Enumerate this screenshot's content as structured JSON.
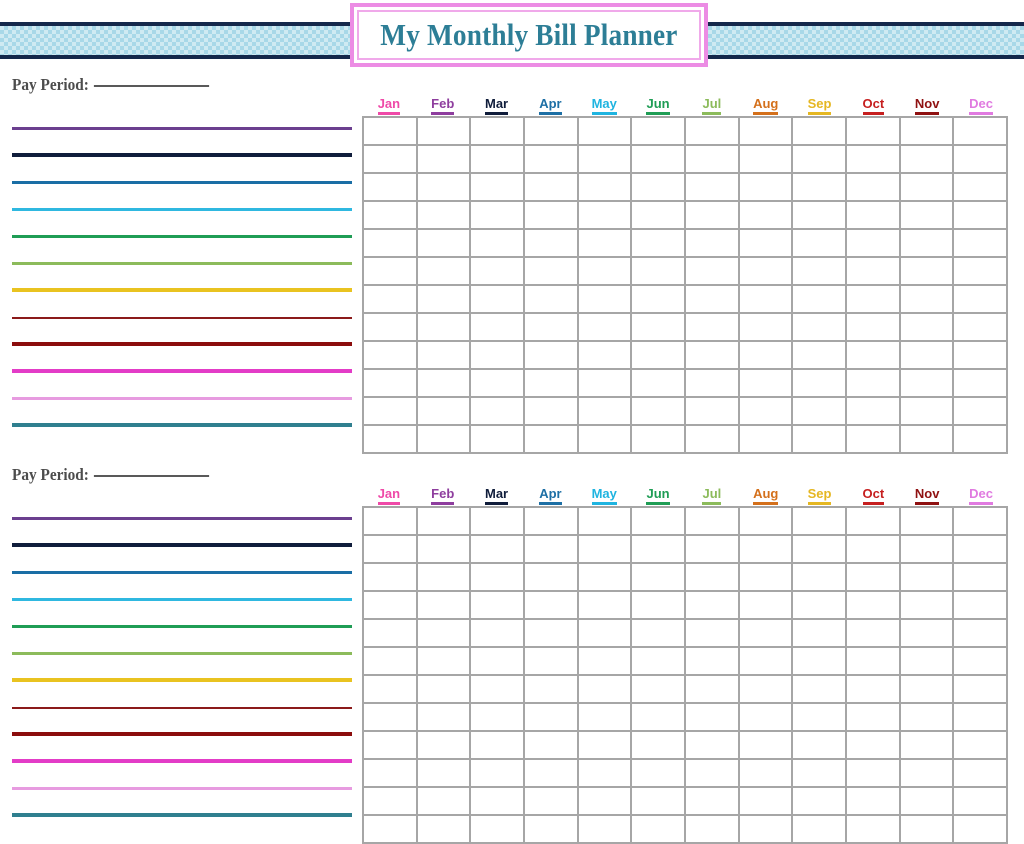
{
  "header": {
    "title": "My Monthly Bill Planner",
    "banner_color": "#cfeaf2",
    "banner_check_color": "#a8d8e8",
    "banner_border_color": "#14284b",
    "title_color": "#2d7e96",
    "title_border_color": "#ec8ce4",
    "title_inner_border_color": "#f0a9ea"
  },
  "months": [
    {
      "label": "Jan",
      "color": "#ef4aa8"
    },
    {
      "label": "Feb",
      "color": "#8e3d9e"
    },
    {
      "label": "Mar",
      "color": "#101d3b"
    },
    {
      "label": "Apr",
      "color": "#1d6fa5"
    },
    {
      "label": "May",
      "color": "#1fb4e0"
    },
    {
      "label": "Jun",
      "color": "#1f9d55"
    },
    {
      "label": "Jul",
      "color": "#8cbb5b"
    },
    {
      "label": "Aug",
      "color": "#d4701b"
    },
    {
      "label": "Sep",
      "color": "#e5b722"
    },
    {
      "label": "Oct",
      "color": "#c61f1f"
    },
    {
      "label": "Nov",
      "color": "#8f1111"
    },
    {
      "label": "Dec",
      "color": "#e07ae0"
    }
  ],
  "line_colors": [
    {
      "color": "#6b3f8f",
      "thickness": 3
    },
    {
      "color": "#101d3b",
      "thickness": 4
    },
    {
      "color": "#1a6ea5",
      "thickness": 3
    },
    {
      "color": "#2fb8e0",
      "thickness": 3
    },
    {
      "color": "#1f9d55",
      "thickness": 3
    },
    {
      "color": "#8cbb5b",
      "thickness": 3
    },
    {
      "color": "#e9c320",
      "thickness": 4
    },
    {
      "color": "#8b1a1a",
      "thickness": 2
    },
    {
      "color": "#8b0d0d",
      "thickness": 4
    },
    {
      "color": "#e33cc7",
      "thickness": 4
    },
    {
      "color": "#e79be0",
      "thickness": 3
    },
    {
      "color": "#2f7f8f",
      "thickness": 4
    }
  ],
  "sections": [
    {
      "pay_period_label": "Pay Period:",
      "pay_period_value": "",
      "rows": 12
    },
    {
      "pay_period_label": "Pay Period:",
      "pay_period_value": "",
      "rows": 12
    }
  ]
}
